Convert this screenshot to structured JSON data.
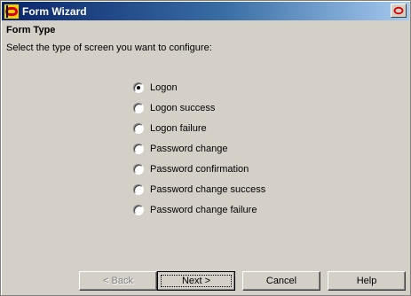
{
  "window": {
    "title": "Form Wizard",
    "app_icon": "oracle-forms-icon",
    "close_icon": "close-icon"
  },
  "page": {
    "section_title": "Form Type",
    "instruction": "Select the type of screen you want to configure:"
  },
  "options": [
    {
      "label": "Logon",
      "checked": true
    },
    {
      "label": "Logon success",
      "checked": false
    },
    {
      "label": "Logon failure",
      "checked": false
    },
    {
      "label": "Password change",
      "checked": false
    },
    {
      "label": "Password confirmation",
      "checked": false
    },
    {
      "label": "Password change success",
      "checked": false
    },
    {
      "label": "Password change failure",
      "checked": false
    }
  ],
  "buttons": {
    "back": "< Back",
    "next": "Next >",
    "cancel": "Cancel",
    "help": "Help"
  },
  "colors": {
    "title_start": "#0a246a",
    "title_end": "#a6caf0",
    "face": "#d4d0c8"
  }
}
